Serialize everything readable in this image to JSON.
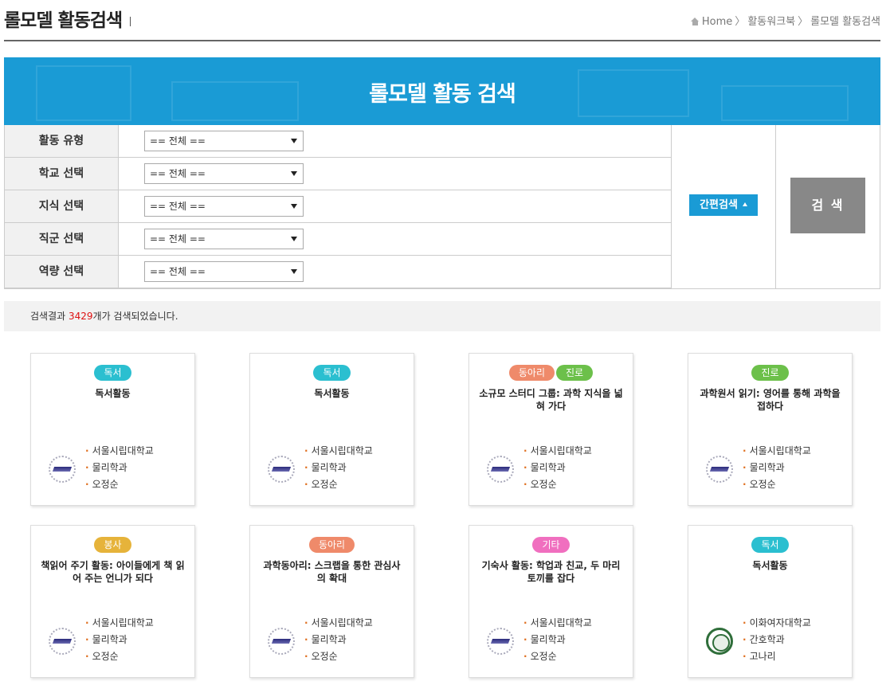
{
  "header": {
    "title": "롤모델 활동검색",
    "breadcrumb": {
      "home": "Home",
      "level1": "활동워크북",
      "level2": "롤모델 활동검색"
    }
  },
  "banner": {
    "title": "롤모델 활동 검색"
  },
  "filters": [
    {
      "label": "활동 유형",
      "value": "== 전체 =="
    },
    {
      "label": "학교 선택",
      "value": "== 전체 =="
    },
    {
      "label": "지식 선택",
      "value": "== 전체 =="
    },
    {
      "label": "직군 선택",
      "value": "== 전체 =="
    },
    {
      "label": "역량 선택",
      "value": "== 전체 =="
    }
  ],
  "quick_search_label": "간편검색",
  "search_button_label": "검 색",
  "result": {
    "prefix": "검색결과 ",
    "count": "3429",
    "suffix": "개가 검색되었습니다."
  },
  "tag_colors": {
    "독서": "#2bbfd0",
    "동아리": "#ef8a6a",
    "진로": "#6cc04a",
    "봉사": "#e6b33a",
    "기타": "#f06fbf"
  },
  "cards": [
    {
      "tags": [
        "독서"
      ],
      "title": "독서활동",
      "logo": "uos",
      "school": "서울시립대학교",
      "dept": "물리학과",
      "name": "오정순"
    },
    {
      "tags": [
        "독서"
      ],
      "title": "독서활동",
      "logo": "uos",
      "school": "서울시립대학교",
      "dept": "물리학과",
      "name": "오정순"
    },
    {
      "tags": [
        "동아리",
        "진로"
      ],
      "title": "소규모 스터디 그룹: 과학 지식을 넓혀 가다",
      "logo": "uos",
      "school": "서울시립대학교",
      "dept": "물리학과",
      "name": "오정순"
    },
    {
      "tags": [
        "진로"
      ],
      "title": "과학원서 읽기: 영어를 통해 과학을 접하다",
      "logo": "uos",
      "school": "서울시립대학교",
      "dept": "물리학과",
      "name": "오정순"
    },
    {
      "tags": [
        "봉사"
      ],
      "title": "책읽어 주기 활동: 아이들에게 책 읽어 주는 언니가 되다",
      "logo": "uos",
      "school": "서울시립대학교",
      "dept": "물리학과",
      "name": "오정순"
    },
    {
      "tags": [
        "동아리"
      ],
      "title": "과학동아리: 스크랩을 통한 관심사의 확대",
      "logo": "uos",
      "school": "서울시립대학교",
      "dept": "물리학과",
      "name": "오정순"
    },
    {
      "tags": [
        "기타"
      ],
      "title": "기숙사 활동: 학업과 친교, 두 마리 토끼를 잡다",
      "logo": "uos",
      "school": "서울시립대학교",
      "dept": "물리학과",
      "name": "오정순"
    },
    {
      "tags": [
        "독서"
      ],
      "title": "독서활동",
      "logo": "ewha",
      "school": "이화여자대학교",
      "dept": "간호학과",
      "name": "고나리"
    }
  ]
}
